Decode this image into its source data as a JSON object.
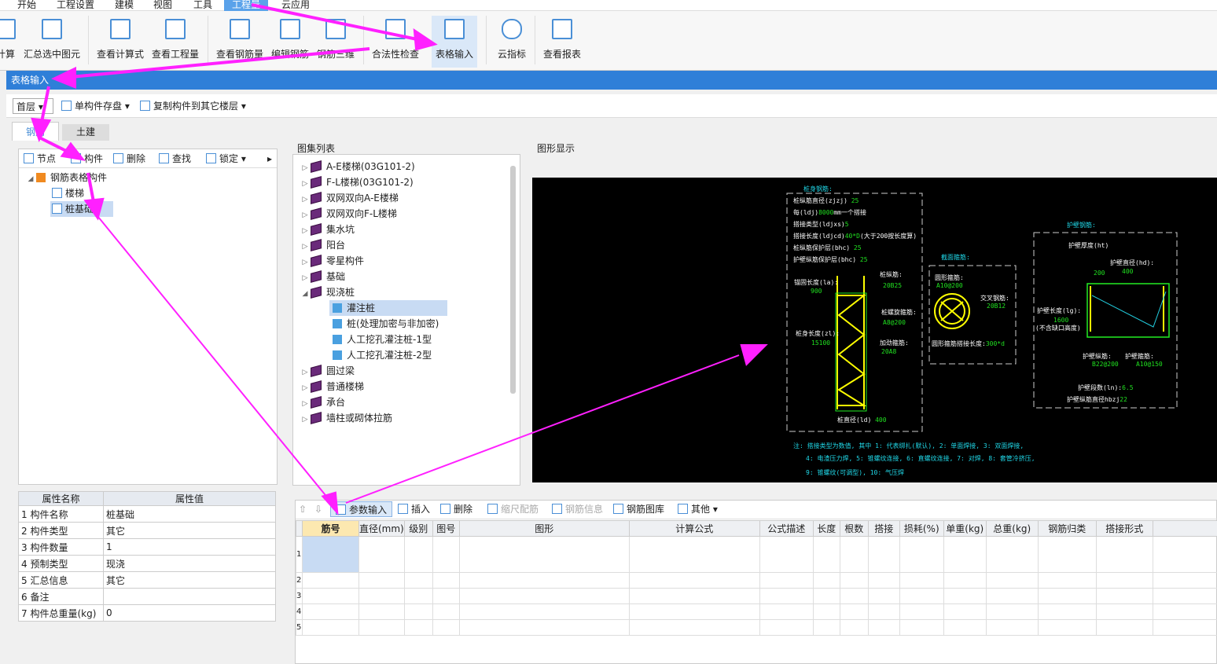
{
  "menu": [
    "开始",
    "工程设置",
    "建模",
    "视图",
    "工具",
    "工程量",
    "云应用"
  ],
  "ribbon": [
    "计算",
    "汇总选中图元",
    "查看计算式",
    "查看工程量",
    "查看钢筋量",
    "编辑钢筋",
    "钢筋三维",
    "合法性检查",
    "表格输入",
    "云指标",
    "查看报表"
  ],
  "title": "表格输入",
  "toolbar": {
    "floor": "首层",
    "save": "单构件存盘",
    "copy": "复制构件到其它楼层"
  },
  "tabs": [
    "钢筋",
    "土建"
  ],
  "left_tools": [
    "节点",
    "构件",
    "删除",
    "查找",
    "锁定"
  ],
  "tree": {
    "root": "钢筋表格构件",
    "items": [
      "楼梯",
      "桩基础"
    ]
  },
  "props": {
    "headers": [
      "属性名称",
      "属性值"
    ],
    "rows": [
      [
        "1",
        "构件名称",
        "桩基础"
      ],
      [
        "2",
        "构件类型",
        "其它"
      ],
      [
        "3",
        "构件数量",
        "1"
      ],
      [
        "4",
        "预制类型",
        "现浇"
      ],
      [
        "5",
        "汇总信息",
        "其它"
      ],
      [
        "6",
        "备注",
        ""
      ],
      [
        "7",
        "构件总重量(kg)",
        "0"
      ]
    ]
  },
  "atlas": {
    "title": "图集列表",
    "items": [
      "A-E楼梯(03G101-2)",
      "F-L楼梯(03G101-2)",
      "双网双向A-E楼梯",
      "双网双向F-L楼梯",
      "集水坑",
      "阳台",
      "零星构件",
      "基础",
      "现浇桩"
    ],
    "children": [
      "灌注桩",
      "桩(处理加密与非加密)",
      "人工挖孔灌注桩-1型",
      "人工挖孔灌注桩-2型"
    ],
    "after": [
      "圆过梁",
      "普通楼梯",
      "承台",
      "墙柱或砌体拉筋"
    ]
  },
  "graphic": {
    "title": "图形显示",
    "pile": {
      "head": "桩身钢筋:",
      "l1": "桩纵筋直径(zjzj)",
      "v1": "25",
      "l2": "每(ldj)",
      "v2": "8000",
      "l2b": "mm一个搭接",
      "l3": "搭接类型(ldjxs)",
      "v3": "5",
      "l4": "搭接长度(ldjcd)",
      "v4": "40*D",
      "l4b": "(大于200按长度算)",
      "l5": "桩纵筋保护层(bhc)",
      "v5": "25",
      "l6": "护壁纵筋保护层(bhc)",
      "v6": "25",
      "anchor": "锚固长度(la):",
      "anchor_v": "900",
      "len": "桩身长度(zl):",
      "len_v": "15100",
      "long": "桩纵筋:",
      "long_v": "20B25",
      "spiral": "桩螺旋箍筋:",
      "spiral_v": "A8@200",
      "add": "加劲箍筋:",
      "add_v": "20A8",
      "dia": "桩直径(ld)",
      "dia_v": "400"
    },
    "section": {
      "head": "截面箍筋:",
      "ring": "圆形箍筋:",
      "ring_v": "A10@200",
      "cross": "交叉钢筋:",
      "cross_v": "20B12",
      "lap": "圆形箍筋搭接长度:",
      "lap_v": "300*d"
    },
    "wall": {
      "head": "护壁钢筋:",
      "ht": "护壁厚度(ht)",
      "ht_v": "200",
      "hd": "护壁直径(hd):",
      "hd_v": "400",
      "lg": "护壁长度(lg):",
      "lg_v": "1600",
      "lg_note": "(不含缺口高度)",
      "long": "护壁纵筋:",
      "long_v": "B22@200",
      "stir": "护壁箍筋:",
      "stir_v": "A10@150",
      "ln": "护壁段数(ln):",
      "ln_v": "6.5",
      "hbzj": "护壁纵筋直径hbzj",
      "hbzj_v": "22"
    },
    "notes": [
      "注: 搭接类型为数值, 其中 1: 代表绑扎(默认), 2: 单面焊接, 3: 双面焊接,",
      "4: 电渣压力焊, 5: 锥螺纹连接, 6: 直螺纹连接, 7: 对焊, 8: 套管冷挤压,",
      "9: 锥螺纹(可调型), 10: 气压焊"
    ]
  },
  "grid": {
    "tools": [
      "参数输入",
      "插入",
      "删除",
      "缩尺配筋",
      "钢筋信息",
      "钢筋图库",
      "其他"
    ],
    "headers": [
      "筋号",
      "直径(mm)",
      "级别",
      "图号",
      "图形",
      "计算公式",
      "公式描述",
      "长度",
      "根数",
      "搭接",
      "损耗(%)",
      "单重(kg)",
      "总重(kg)",
      "钢筋归类",
      "搭接形式"
    ],
    "rows": [
      "1",
      "2",
      "3",
      "4",
      "5"
    ]
  },
  "colors": {
    "accent": "#2f7fd8",
    "annotation": "#ff20ff",
    "cad_bg": "#000000"
  }
}
